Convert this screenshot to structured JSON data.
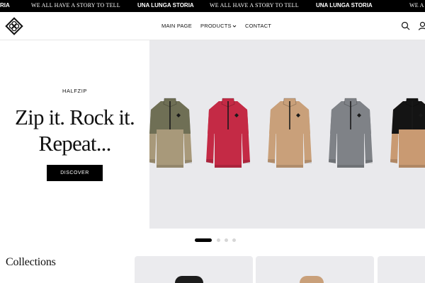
{
  "ticker": {
    "items": [
      {
        "text": "RIA",
        "style": "sans"
      },
      {
        "text": "WE ALL HAVE A STORY TO TELL",
        "style": "serif"
      },
      {
        "text": "UNA LUNGA STORIA",
        "style": "sans"
      },
      {
        "text": "WE ALL HAVE A STORY TO TELL",
        "style": "serif"
      },
      {
        "text": "UNA LUNGA STORIA",
        "style": "sans"
      },
      {
        "text": "WE A",
        "style": "serif"
      }
    ]
  },
  "header": {
    "logo_icon": "diamond-knot-logo",
    "nav": {
      "main_page": "MAIN PAGE",
      "products": "PRODUCTS",
      "contact": "CONTACT"
    },
    "icons": [
      "search-icon",
      "account-icon"
    ]
  },
  "hero": {
    "kicker": "HALFZIP",
    "headline_line1": "Zip it. Rock it.",
    "headline_line2": "Repeat...",
    "cta_label": "DISCOVER",
    "background_color": "#e9e9ec",
    "products": [
      {
        "name": "olive-khaki-halfzip",
        "top_color": "#6f6f55",
        "bottom_color": "#a8997a"
      },
      {
        "name": "red-halfzip",
        "top_color": "#c42a45",
        "bottom_color": "#c42a45"
      },
      {
        "name": "camel-halfzip",
        "top_color": "#c9a07a",
        "bottom_color": "#c9a07a"
      },
      {
        "name": "grey-halfzip",
        "top_color": "#7f8287",
        "bottom_color": "#7f8287"
      },
      {
        "name": "black-camel-halfzip",
        "top_color": "#141414",
        "bottom_color": "#c99a72"
      }
    ]
  },
  "carousel": {
    "slide_count": 4,
    "active_index": 0
  },
  "collections": {
    "title": "Collections",
    "cards": [
      {
        "name": "collection-card-dark",
        "thumb_color": "#1c1c1c"
      },
      {
        "name": "collection-card-camel",
        "thumb_color": "#c9a07a"
      },
      {
        "name": "collection-card-third",
        "thumb_color": "#ebebee"
      }
    ]
  }
}
